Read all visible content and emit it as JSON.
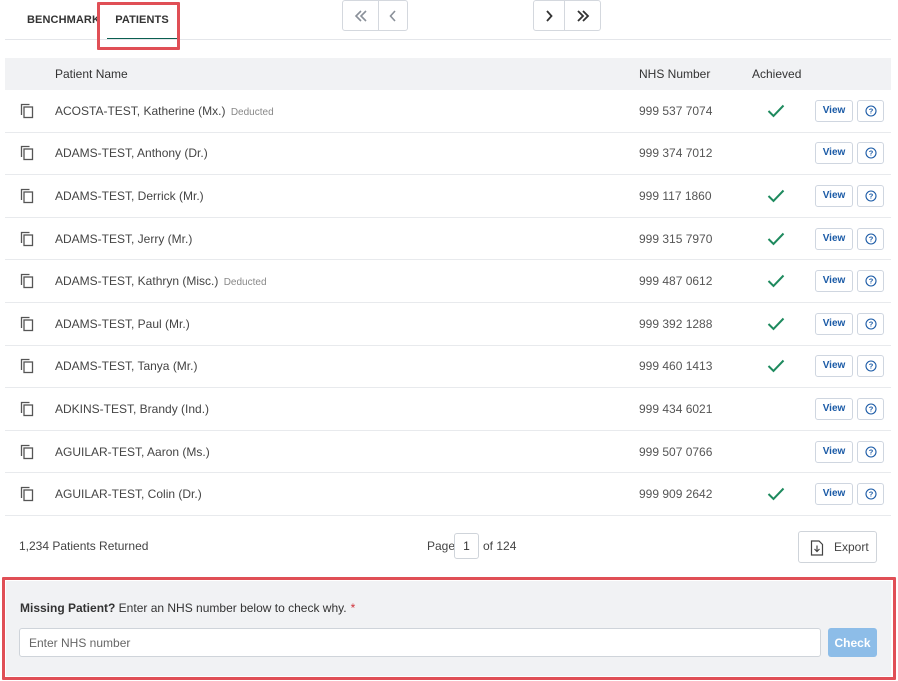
{
  "tabs": [
    {
      "label": "BENCHMARK",
      "active": false
    },
    {
      "label": "PATIENTS",
      "active": true
    }
  ],
  "table": {
    "headers": {
      "name": "Patient Name",
      "nhs": "NHS Number",
      "achieved": "Achieved"
    },
    "rows": [
      {
        "name": "ACOSTA-TEST, Katherine (Mx.)",
        "status": "Deducted",
        "nhs": "999 537 7074",
        "achieved": true
      },
      {
        "name": "ADAMS-TEST, Anthony (Dr.)",
        "status": "",
        "nhs": "999 374 7012",
        "achieved": false
      },
      {
        "name": "ADAMS-TEST, Derrick (Mr.)",
        "status": "",
        "nhs": "999 117 1860",
        "achieved": true
      },
      {
        "name": "ADAMS-TEST, Jerry (Mr.)",
        "status": "",
        "nhs": "999 315 7970",
        "achieved": true
      },
      {
        "name": "ADAMS-TEST, Kathryn (Misc.)",
        "status": "Deducted",
        "nhs": "999 487 0612",
        "achieved": true
      },
      {
        "name": "ADAMS-TEST, Paul (Mr.)",
        "status": "",
        "nhs": "999 392 1288",
        "achieved": true
      },
      {
        "name": "ADAMS-TEST, Tanya (Mr.)",
        "status": "",
        "nhs": "999 460 1413",
        "achieved": true
      },
      {
        "name": "ADKINS-TEST, Brandy (Ind.)",
        "status": "",
        "nhs": "999 434 6021",
        "achieved": false
      },
      {
        "name": "AGUILAR-TEST, Aaron (Ms.)",
        "status": "",
        "nhs": "999 507 0766",
        "achieved": false
      },
      {
        "name": "AGUILAR-TEST, Colin (Dr.)",
        "status": "",
        "nhs": "999 909 2642",
        "achieved": true
      }
    ],
    "view_label": "View"
  },
  "footer": {
    "returned": "1,234 Patients Returned",
    "page_label": "Page",
    "page_value": "1",
    "of_label": "of 124",
    "export_label": "Export"
  },
  "missing": {
    "bold": "Missing Patient?",
    "text": " Enter an NHS number below to check why.",
    "required": "*",
    "placeholder": "Enter NHS number",
    "check_label": "Check"
  },
  "colors": {
    "check": "#1e8a5e",
    "link": "#1a5aa6",
    "highlight": "#e04f56",
    "check_button": "#8dbde8"
  }
}
